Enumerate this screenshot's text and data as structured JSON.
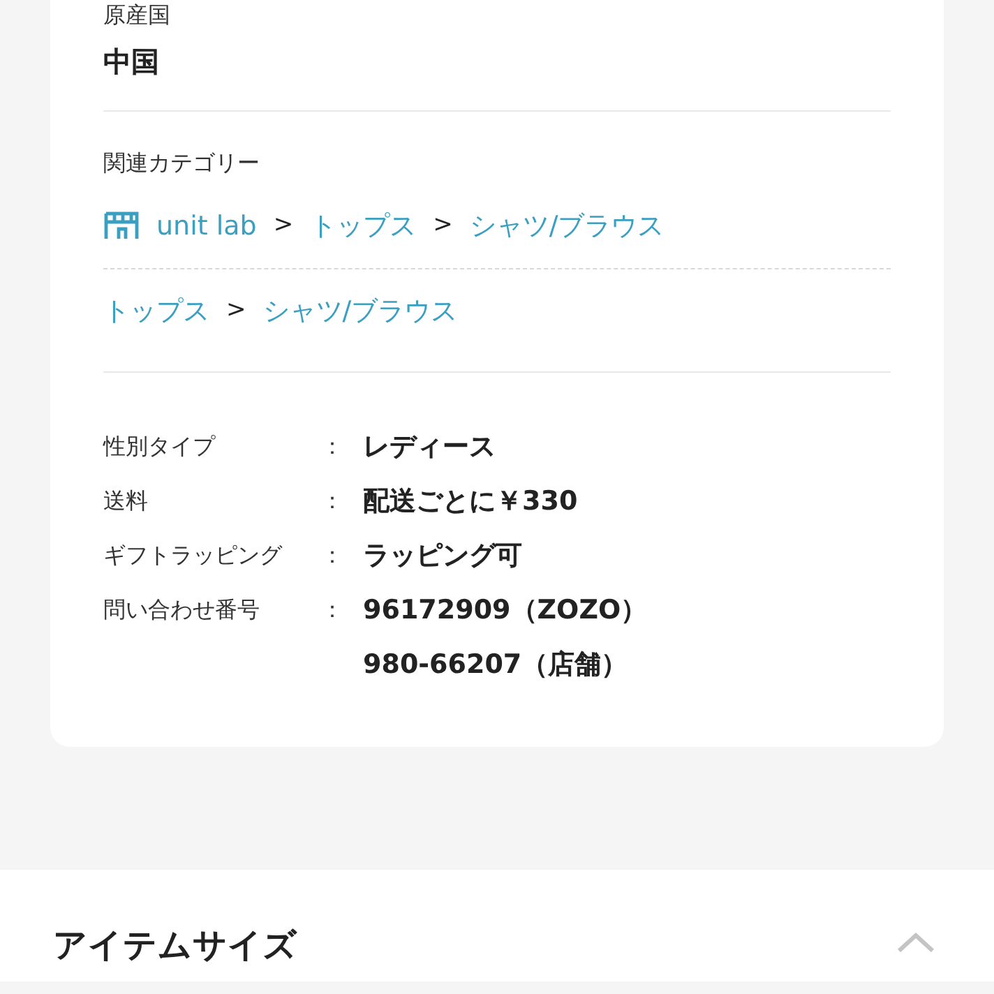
{
  "origin": {
    "label": "原産国",
    "value": "中国"
  },
  "related_categories": {
    "label": "関連カテゴリー",
    "separator": ">",
    "paths": [
      {
        "items": [
          {
            "label": "unit lab",
            "kind": "shop"
          },
          {
            "label": "トップス",
            "kind": "category"
          },
          {
            "label": "シャツ/ブラウス",
            "kind": "category"
          }
        ]
      },
      {
        "items": [
          {
            "label": "トップス",
            "kind": "category"
          },
          {
            "label": "シャツ/ブラウス",
            "kind": "category"
          }
        ]
      }
    ]
  },
  "details": {
    "colon": "：",
    "rows": [
      {
        "label": "性別タイプ",
        "values": [
          "レディース"
        ]
      },
      {
        "label": "送料",
        "values": [
          "配送ごとに￥330"
        ]
      },
      {
        "label": "ギフトラッピング",
        "values": [
          "ラッピング可"
        ]
      },
      {
        "label": "問い合わせ番号",
        "values": [
          "96172909（ZOZO）",
          "980-66207（店舗）"
        ]
      }
    ]
  },
  "item_size": {
    "title": "アイテムサイズ",
    "expanded": true
  }
}
